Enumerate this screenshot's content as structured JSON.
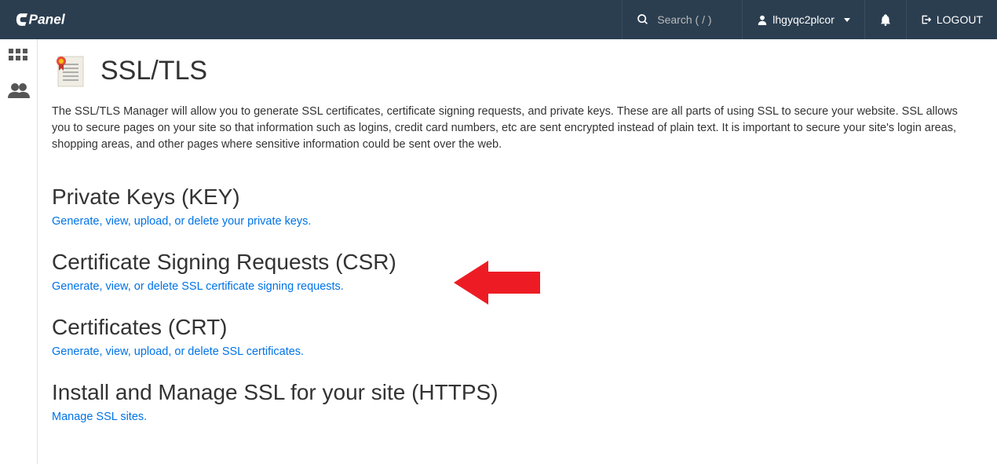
{
  "header": {
    "search_placeholder": "Search ( / )",
    "username": "lhgyqc2plcor",
    "logout_label": "LOGOUT"
  },
  "page": {
    "title": "SSL/TLS",
    "intro": "The SSL/TLS Manager will allow you to generate SSL certificates, certificate signing requests, and private keys. These are all parts of using SSL to secure your website. SSL allows you to secure pages on your site so that information such as logins, credit card numbers, etc are sent encrypted instead of plain text. It is important to secure your site's login areas, shopping areas, and other pages where sensitive information could be sent over the web."
  },
  "sections": {
    "key": {
      "heading": "Private Keys (KEY)",
      "link": "Generate, view, upload, or delete your private keys."
    },
    "csr": {
      "heading": "Certificate Signing Requests (CSR)",
      "link": "Generate, view, or delete SSL certificate signing requests."
    },
    "crt": {
      "heading": "Certificates (CRT)",
      "link": "Generate, view, upload, or delete SSL certificates."
    },
    "https": {
      "heading": "Install and Manage SSL for your site (HTTPS)",
      "link": "Manage SSL sites."
    }
  }
}
